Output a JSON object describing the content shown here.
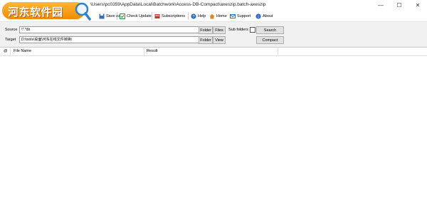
{
  "window": {
    "title": "\\Users\\pc0359\\AppData\\Local\\Batchwork\\Access-DB-Compact\\axeszip.batch-axeszip",
    "controls": {
      "minimize": "—",
      "maximize": "☐",
      "close": "✕"
    }
  },
  "logo": {
    "text": "河东软件园"
  },
  "toolbar": {
    "save_as": "Save As",
    "check_update": "Check Update",
    "subscriptions": "Subscriptions",
    "help": "Help",
    "home": "Home",
    "support": "Support",
    "about": "About"
  },
  "form": {
    "source_label": "Source",
    "source_value": "\\*.*db",
    "target_label": "Target",
    "target_value": "D:\\tools\\桌面\\河东在线文件转换\\",
    "folder_label": "Folder",
    "files_label": "Files",
    "view_label": "View",
    "subfolders_label": "Sub folders",
    "search_label": "Search",
    "compact_label": "Compact"
  },
  "grid": {
    "columns": [
      "@",
      "File Name",
      "Result"
    ]
  },
  "colors": {
    "logo_orange": "#f08a00",
    "panel_bg": "#f0f0f0"
  }
}
